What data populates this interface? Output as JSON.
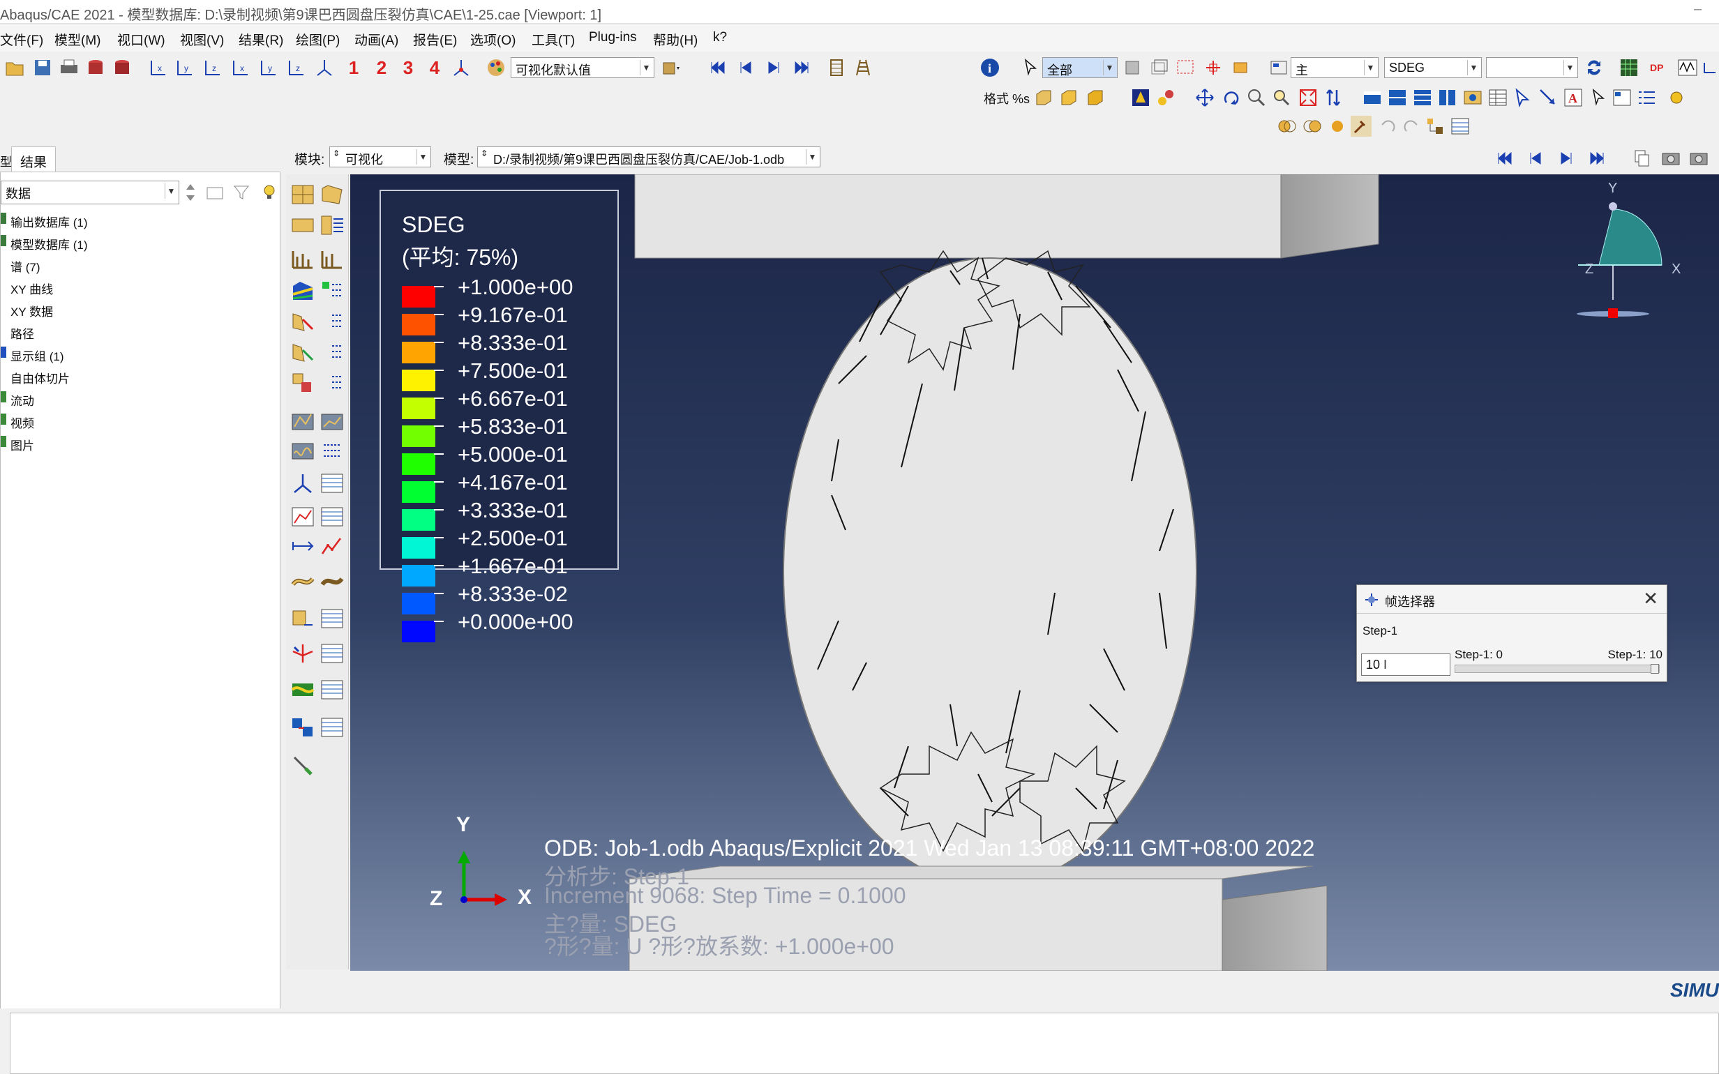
{
  "window": {
    "title": "Abaqus/CAE 2021 - 模型数据库: D:\\录制视频\\第9课巴西圆盘压裂仿真\\CAE\\1-25.cae [Viewport: 1]"
  },
  "menu": [
    "文件(F)",
    "模型(M)",
    "视口(W)",
    "视图(V)",
    "结果(R)",
    "绘图(P)",
    "动画(A)",
    "报告(E)",
    "选项(O)",
    "工具(T)",
    "Plug-ins",
    "帮助(H)",
    "k?"
  ],
  "toolbar": {
    "steps": [
      "1",
      "2",
      "3",
      "4"
    ],
    "render_style": "可视化默认值",
    "selection_filter": "全部",
    "field_type": "主",
    "field_var": "SDEG",
    "field_comp": "",
    "format_label": "格式 %s"
  },
  "context_bar": {
    "module_label": "模块:",
    "module_value": "可视化",
    "model_label": "模型:",
    "model_value": "D:/录制视频/第9课巴西圆盘压裂仿真/CAE/Job-1.odb"
  },
  "left_panel": {
    "tab_model": "型",
    "tab_results": "结果",
    "combo_value": "数据",
    "tree": [
      "输出数据库 (1)",
      "模型数据库 (1)",
      "谱 (7)",
      "XY 曲线",
      "XY 数据",
      "路径",
      "显示组 (1)",
      "自由体切片",
      "流动",
      "视频",
      "图片"
    ]
  },
  "legend": {
    "title": "SDEG",
    "subtitle": "(平均: 75%)",
    "values": [
      "+1.000e+00",
      "+9.167e-01",
      "+8.333e-01",
      "+7.500e-01",
      "+6.667e-01",
      "+5.833e-01",
      "+5.000e-01",
      "+4.167e-01",
      "+3.333e-01",
      "+2.500e-01",
      "+1.667e-01",
      "+8.333e-02",
      "+0.000e+00"
    ],
    "colors": [
      "#ff0000",
      "#ff5200",
      "#ffa400",
      "#fff200",
      "#c4ff00",
      "#72ff00",
      "#20ff00",
      "#00ff30",
      "#00ff82",
      "#00f6d4",
      "#00a8ff",
      "#0058ff",
      "#0008ff"
    ]
  },
  "viewport": {
    "odb_line": "ODB: Job-1.odb    Abaqus/Explicit 2021    Wed Jan 13 08:39:11 GMT+08:00 2022",
    "step_line": "分析步: Step-1",
    "increment_line": "Increment     9068: Step Time =    0.1000",
    "primary_var": "主?量: SDEG",
    "deformed_var": "?形?量: U   ?形?放系数: +1.000e+00",
    "triad_x": "X",
    "triad_y": "Y",
    "triad_z": "Z"
  },
  "frame_selector": {
    "title": "帧选择器",
    "step": "Step-1",
    "value": "10",
    "min_label": "Step-1: 0",
    "max_label": "Step-1: 10"
  },
  "status": {
    "brand": "SIMU"
  }
}
